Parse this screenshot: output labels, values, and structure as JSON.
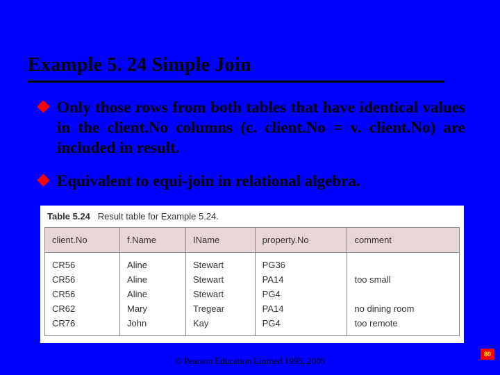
{
  "title": "Example 5. 24  Simple Join",
  "bullets": [
    "Only those rows from both tables that have identical values in the client.No columns (c. client.No = v. client.No) are included in result.",
    "Equivalent to equi-join in relational algebra."
  ],
  "table": {
    "caption_label": "Table 5.24",
    "caption_text": "Result table for Example 5.24.",
    "headers": [
      "client.No",
      "f.Name",
      "IName",
      "property.No",
      "comment"
    ],
    "rows": [
      [
        "CR56",
        "Aline",
        "Stewart",
        "PG36",
        ""
      ],
      [
        "CR56",
        "Aline",
        "Stewart",
        "PA14",
        "too small"
      ],
      [
        "CR56",
        "Aline",
        "Stewart",
        "PG4",
        ""
      ],
      [
        "CR62",
        "Mary",
        "Tregear",
        "PA14",
        "no dining room"
      ],
      [
        "CR76",
        "John",
        "Kay",
        "PG4",
        "too remote"
      ]
    ]
  },
  "footer": "© Pearson Education Limited 1995, 2005",
  "page_number": "80"
}
